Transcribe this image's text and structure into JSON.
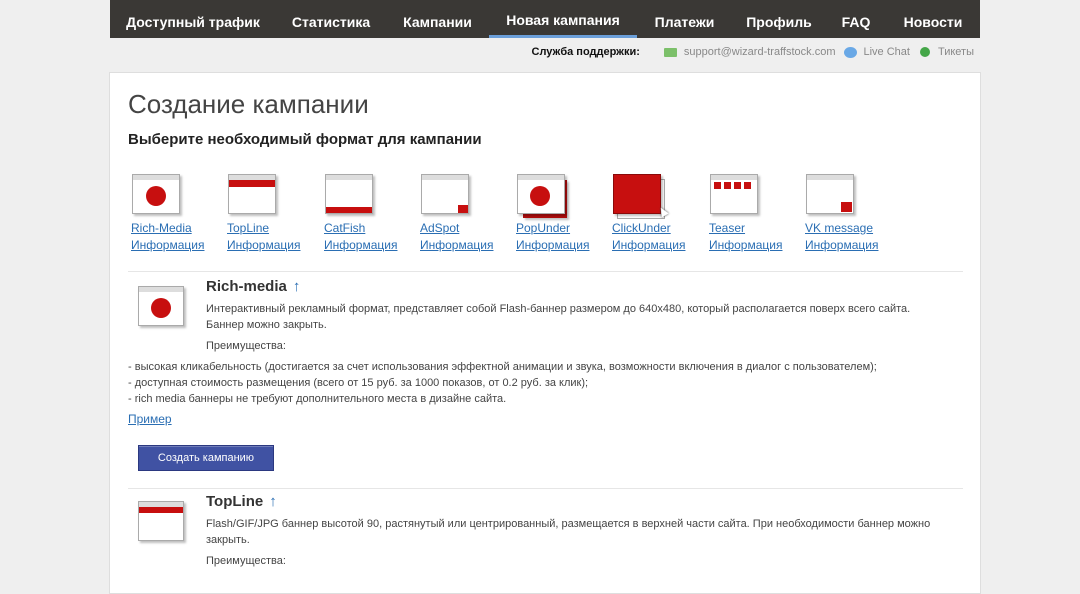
{
  "nav": {
    "items": [
      {
        "label": "Доступный трафик",
        "active": false
      },
      {
        "label": "Статистика",
        "active": false
      },
      {
        "label": "Кампании",
        "active": false
      },
      {
        "label": "Новая кампания",
        "active": true
      },
      {
        "label": "Платежи",
        "active": false
      },
      {
        "label": "Профиль",
        "active": false
      },
      {
        "label": "FAQ",
        "active": false
      },
      {
        "label": "Новости",
        "active": false
      }
    ]
  },
  "support": {
    "label": "Служба поддержки:",
    "email": "support@wizard-traffstock.com",
    "chat": "Live Chat",
    "tickets": "Тикеты"
  },
  "page": {
    "title": "Создание кампании",
    "subtitle": "Выберите необходимый формат для кампании"
  },
  "formats": [
    {
      "name": "Rich-Media",
      "info": "Информация"
    },
    {
      "name": "TopLine",
      "info": "Информация"
    },
    {
      "name": "CatFish",
      "info": "Информация"
    },
    {
      "name": "AdSpot",
      "info": "Информация"
    },
    {
      "name": "PopUnder",
      "info": "Информация"
    },
    {
      "name": "ClickUnder",
      "info": "Информация"
    },
    {
      "name": "Teaser",
      "info": "Информация"
    },
    {
      "name": "VK message",
      "info": "Информация"
    }
  ],
  "richmedia": {
    "title": "Rich-media",
    "arrow": "↑",
    "desc1": "Интерактивный рекламный формат, представляет собой Flash-баннер размером до 640x480, который располагается поверх всего сайта.",
    "desc2": "Баннер можно закрыть.",
    "adv_label": "Преимущества:",
    "adv": [
      "- высокая кликабельность (достигается за счет использования эффектной анимации и звука, возможности включения в диалог с пользователем);",
      "- доступная стоимость размещения (всего от 15 руб. за 1000 показов, от 0.2 руб. за клик);",
      "- rich media баннеры не требуют дополнительного места в дизайне сайта."
    ],
    "example": "Пример",
    "create_button": "Создать кампанию"
  },
  "topline": {
    "title": "TopLine",
    "arrow": "↑",
    "desc1": "Flash/GIF/JPG баннер высотой 90, растянутый или центрированный, размещается в верхней части сайта. При необходимости баннер можно",
    "desc2": "закрыть.",
    "adv_label": "Преимущества:"
  },
  "colors": {
    "accent": "#c70f0f",
    "link": "#2a6eb3",
    "nav_bg": "#3a3835",
    "button": "#4052a3"
  }
}
